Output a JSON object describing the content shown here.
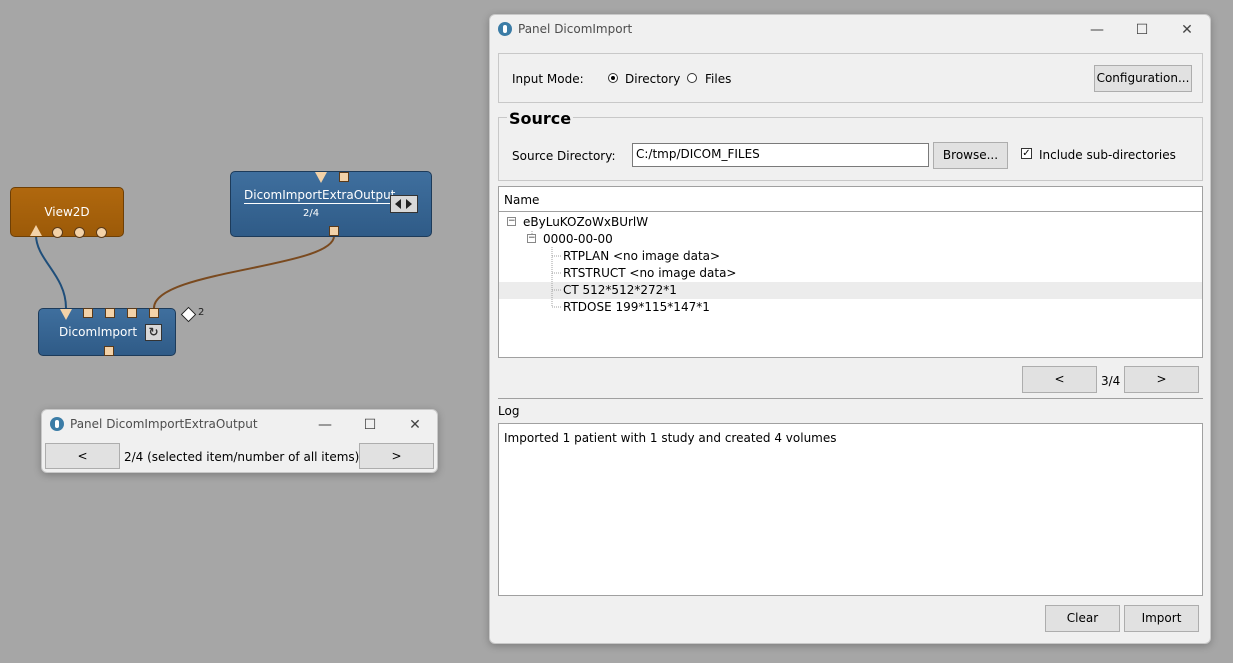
{
  "network": {
    "view2d": {
      "title": "View2D"
    },
    "dicom_import": {
      "title": "DicomImport",
      "badge": "2"
    },
    "extra_output": {
      "title": "DicomImportExtraOutput",
      "counter": "2/4"
    },
    "colors": {
      "module_blue": "#3a6898",
      "module_orange": "#a8620b",
      "connection_blue": "#1f4e7a",
      "connection_brown": "#7a4a1f"
    }
  },
  "extra_panel": {
    "title": "Panel DicomImportExtraOutput",
    "prev_label": "<",
    "status": "2/4  (selected item/number of all items)",
    "next_label": ">"
  },
  "main_panel": {
    "title": "Panel DicomImport",
    "input_mode": {
      "label": "Input Mode:",
      "options": [
        "Directory",
        "Files"
      ],
      "selected": "Directory"
    },
    "configuration_label": "Configuration...",
    "source": {
      "heading": "Source",
      "dir_label": "Source Directory:",
      "dir_value": "C:/tmp/DICOM_FILES",
      "browse_label": "Browse...",
      "include_sub_label": "Include sub-directories",
      "include_sub_checked": true
    },
    "tree": {
      "header": "Name",
      "patient": "eByLuKOZoWxBUrlW",
      "study": "0000-00-00",
      "items": [
        "RTPLAN <no image data>",
        "RTSTRUCT <no image data>",
        "CT 512*512*272*1",
        "RTDOSE 199*115*147*1"
      ],
      "selected_index": 2
    },
    "pager": {
      "prev_label": "<",
      "status": "3/4",
      "next_label": ">"
    },
    "log": {
      "label": "Log",
      "text": "Imported 1 patient with 1 study and created 4 volumes"
    },
    "clear_label": "Clear",
    "import_label": "Import"
  },
  "window_buttons": {
    "minimize": "—",
    "maximize": "☐",
    "close": "✕"
  }
}
